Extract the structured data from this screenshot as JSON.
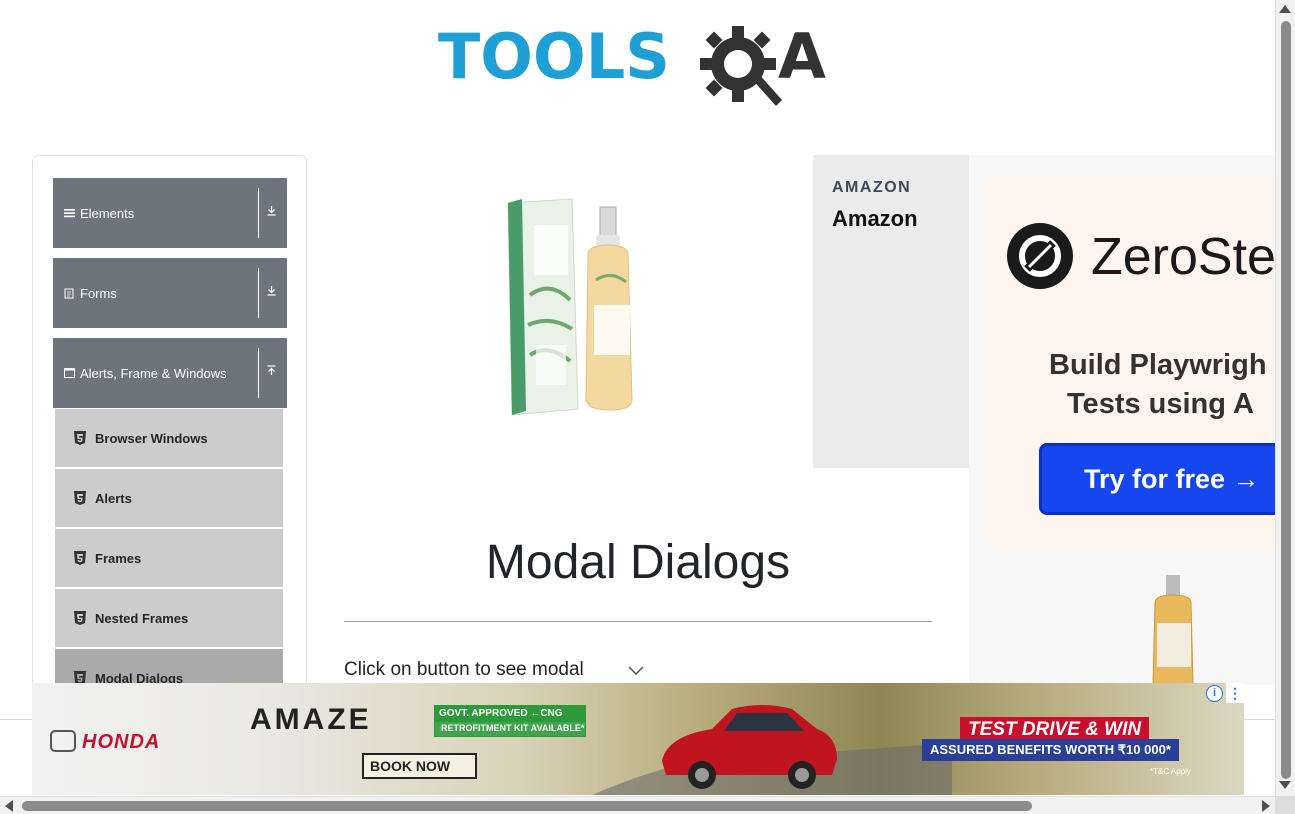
{
  "header": {
    "logo_tools": "TOOLS",
    "logo_a": "A"
  },
  "sidebar": {
    "groups": [
      {
        "label": "Elements",
        "icon": "hamburger-icon",
        "arrow": "download-arrow-icon"
      },
      {
        "label": "Forms",
        "icon": "doc-icon",
        "arrow": "download-arrow-icon"
      },
      {
        "label": "Alerts, Frame & Windows",
        "icon": "window-icon",
        "arrow": "upload-arrow-icon"
      }
    ],
    "items": [
      {
        "label": "Browser Windows",
        "icon": "html5-icon"
      },
      {
        "label": "Alerts",
        "icon": "html5-icon"
      },
      {
        "label": "Frames",
        "icon": "html5-icon"
      },
      {
        "label": "Nested Frames",
        "icon": "html5-icon"
      },
      {
        "label": "Modal Dialogs",
        "icon": "html5-icon",
        "active": true
      }
    ]
  },
  "product_ad": {
    "brand_small": "AMAZON",
    "brand_big": "Amazon"
  },
  "side_ad": {
    "name": "ZeroSte",
    "tagline_1": "Build Playwrigh",
    "tagline_2": "Tests using A",
    "button": "Try for free →"
  },
  "main": {
    "title": "Modal Dialogs",
    "subtitle": "Click on button to see modal"
  },
  "bottom_ad": {
    "brand": "HONDA",
    "model": "AMAZE",
    "govt_top": "GOVT. APPROVED  ←CNG",
    "govt_bottom": "RETROFITMENT KIT AVAILABLE*",
    "book_now": "BOOK NOW",
    "test_drive": "TEST DRIVE & WIN",
    "assured": "ASSURED BENEFITS WORTH ₹10 000*",
    "tc": "*T&C Apply",
    "info_icon": "i",
    "menu_icon": "⋮"
  },
  "colors": {
    "logo_blue": "#1e9fd5",
    "sidebar_header": "#6c757d",
    "sidebar_item": "#cccccc",
    "sidebar_item_active": "#aaaaaa",
    "cta_blue": "#1546ee"
  }
}
